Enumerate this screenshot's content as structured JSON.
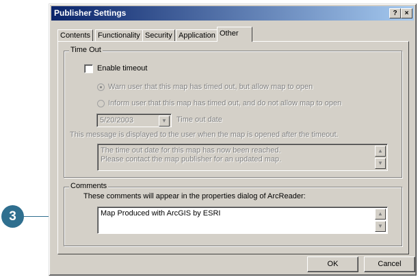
{
  "callout": {
    "number": "3"
  },
  "window": {
    "title": "Publisher Settings",
    "help_label": "?",
    "close_label": "×"
  },
  "tabs": [
    {
      "label": "Contents"
    },
    {
      "label": "Functionality"
    },
    {
      "label": "Security"
    },
    {
      "label": "Application"
    },
    {
      "label": "Other"
    }
  ],
  "timeout": {
    "legend": "Time Out",
    "enable_label": "Enable timeout",
    "enable_checked": false,
    "option_warn": "Warn user that this map has timed out, but allow map to open",
    "option_inform": "Inform user that this map has timed out, and do not allow map to open",
    "date_value": "5/20/2003",
    "date_label": "Time out date",
    "message_hint": "This message is displayed to the user when the  map is opened after the timeout.",
    "message_text": "The time out date for this map has now been reached.\nPlease contact the map publisher for an updated map."
  },
  "comments": {
    "legend": "Comments",
    "hint": "These comments will appear in the properties dialog of ArcReader:",
    "value": "Map Produced with ArcGIS by ESRI"
  },
  "buttons": {
    "ok": "OK",
    "cancel": "Cancel"
  },
  "icons": {
    "scroll_up": "▲",
    "scroll_down": "▼",
    "dropdown": "▼"
  }
}
